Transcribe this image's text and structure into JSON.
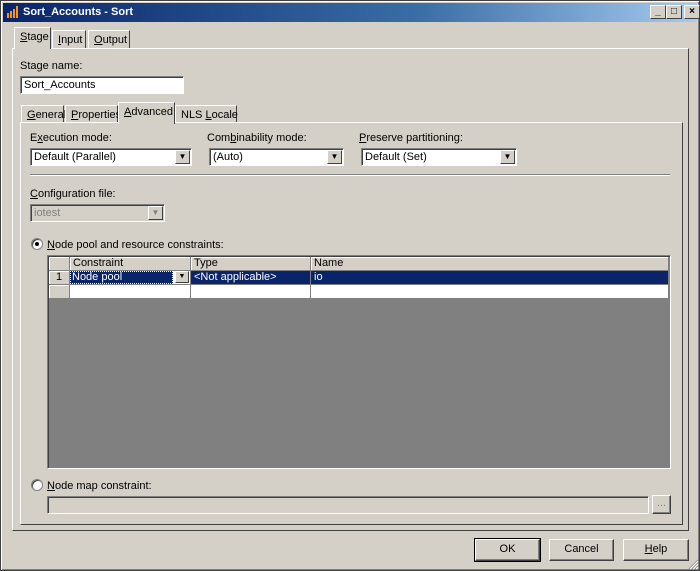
{
  "window": {
    "title": "Sort_Accounts - Sort"
  },
  "top_tabs": [
    {
      "pre": "",
      "accel": "S",
      "post": "tage"
    },
    {
      "pre": "",
      "accel": "I",
      "post": "nput"
    },
    {
      "pre": "",
      "accel": "O",
      "post": "utput"
    }
  ],
  "stage": {
    "label": "Stage name:",
    "value": "Sort_Accounts"
  },
  "sub_tabs": [
    {
      "pre": "",
      "accel": "G",
      "post": "eneral"
    },
    {
      "pre": "",
      "accel": "P",
      "post": "roperties"
    },
    {
      "pre": "",
      "accel": "A",
      "post": "dvanced"
    },
    {
      "pre": "NLS ",
      "accel": "L",
      "post": "ocale"
    }
  ],
  "advanced": {
    "execution_mode": {
      "pre": "E",
      "accel": "x",
      "post": "ecution mode:",
      "value": "Default (Parallel)"
    },
    "combinability_mode": {
      "pre": "Com",
      "accel": "b",
      "post": "inability mode:",
      "value": "(Auto)"
    },
    "preserve_partitioning": {
      "pre": "",
      "accel": "P",
      "post": "reserve partitioning:",
      "value": "Default (Set)"
    },
    "configuration_file": {
      "pre": "",
      "accel": "C",
      "post": "onfiguration file:",
      "value": "iotest"
    },
    "node_pool": {
      "pre": "",
      "accel": "N",
      "post": "ode pool and resource constraints:"
    },
    "node_map": {
      "pre": "",
      "accel": "N",
      "post": "ode map constraint:",
      "value": ""
    },
    "browse_label": "..."
  },
  "grid": {
    "columns": [
      "Constraint",
      "Type",
      "Name"
    ],
    "rows": [
      {
        "num": "1",
        "constraint": "Node pool",
        "type": "<Not applicable>",
        "name": "io"
      }
    ]
  },
  "buttons": {
    "ok": "OK",
    "cancel": "Cancel",
    "help": {
      "pre": "",
      "accel": "H",
      "post": "elp"
    }
  }
}
